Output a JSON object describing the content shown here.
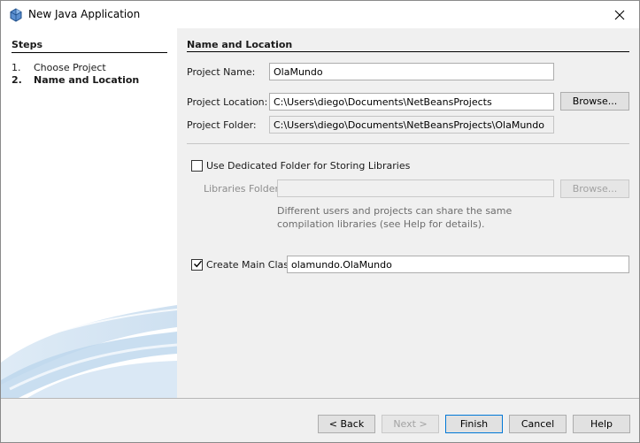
{
  "window": {
    "title": "New Java Application",
    "app_icon": "java-cup-icon",
    "close_icon": "close-icon"
  },
  "steps": {
    "title": "Steps",
    "items": [
      {
        "num": "1.",
        "label": "Choose Project",
        "active": false
      },
      {
        "num": "2.",
        "label": "Name and Location",
        "active": true
      }
    ]
  },
  "form": {
    "section_title": "Name and Location",
    "project_name_label": "Project Name:",
    "project_name_value": "OlaMundo",
    "project_location_label": "Project Location:",
    "project_location_value": "C:\\Users\\diego\\Documents\\NetBeansProjects",
    "browse_label": "Browse...",
    "project_folder_label": "Project Folder:",
    "project_folder_value": "C:\\Users\\diego\\Documents\\NetBeansProjects\\OlaMundo",
    "dedicated_folder_label": "Use Dedicated Folder for Storing Libraries",
    "dedicated_folder_checked": false,
    "libraries_folder_label": "Libraries Folder:",
    "libraries_folder_value": "",
    "libraries_browse_label": "Browse...",
    "help_text": "Different users and projects can share the same compilation libraries (see Help for details).",
    "create_main_class_label": "Create Main Class",
    "create_main_class_checked": true,
    "main_class_value": "olamundo.OlaMundo"
  },
  "footer": {
    "back_label": "< Back",
    "next_label": "Next >",
    "finish_label": "Finish",
    "cancel_label": "Cancel",
    "help_label": "Help"
  },
  "colors": {
    "dialog_bg": "#f0f0f0",
    "focus_border": "#0078d7",
    "swoosh": "#bcd6ec"
  }
}
